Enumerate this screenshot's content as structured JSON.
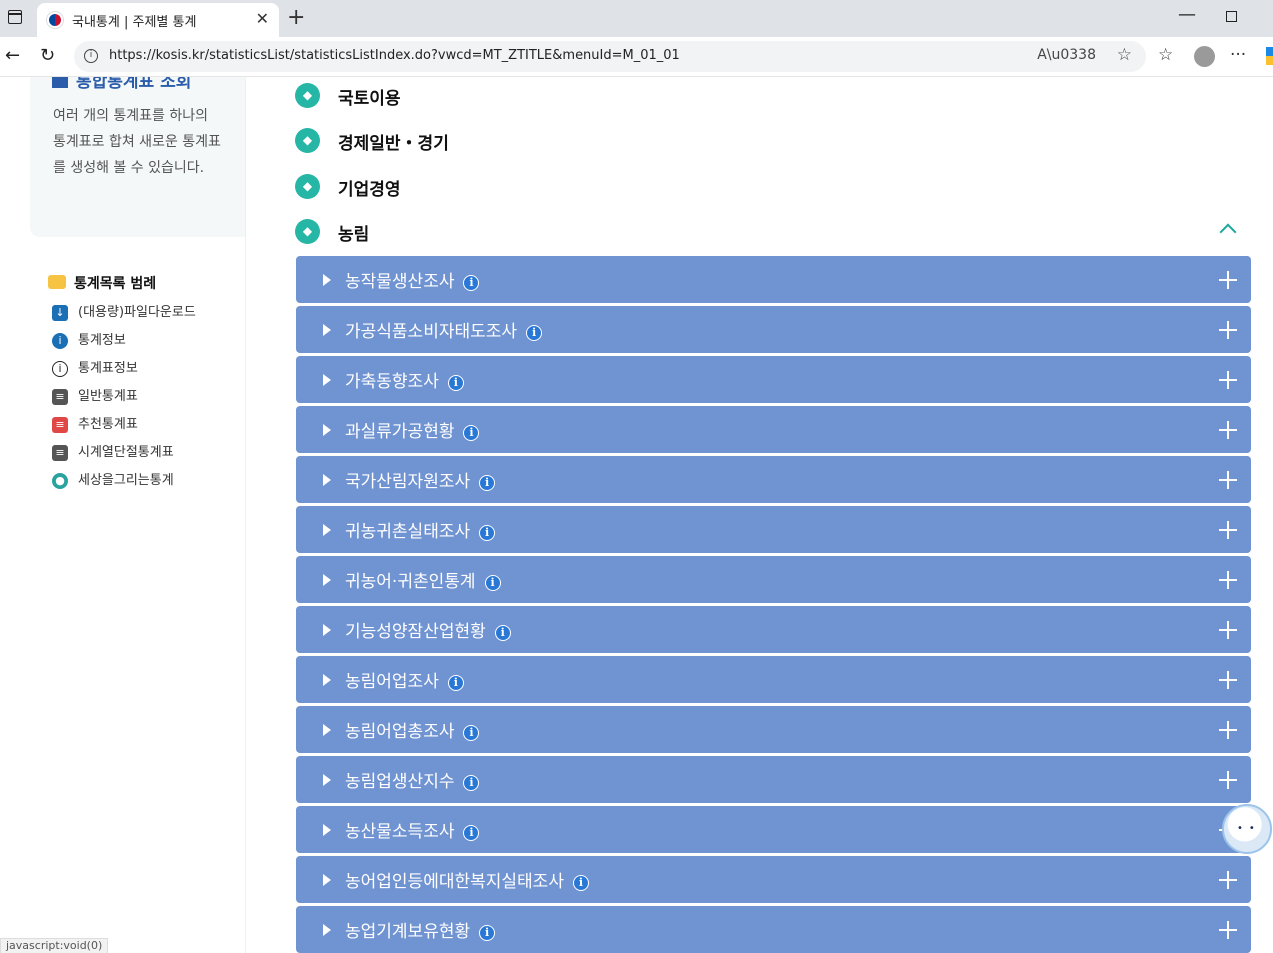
{
  "browser": {
    "tab_title": "국내통계 | 주제별 통계",
    "url": "https://kosis.kr/statisticsList/statisticsListIndex.do?vwcd=MT_ZTITLE&menuId=M_01_01",
    "read_aloud": "A̸"
  },
  "sidebar": {
    "promo_title": "통합통계표 조회",
    "promo_desc": "여러 개의 통계표를 하나의 통계표로 합쳐 새로운 통계표를 생성해 볼 수 있습니다.",
    "legend_title": "통계목록 범례",
    "legend_items": [
      {
        "label": "(대용량)파일다운로드",
        "icon": "download-icon",
        "color": "#1a6fb5"
      },
      {
        "label": "통계정보",
        "icon": "info-filled-icon",
        "color": "#1a6fb5"
      },
      {
        "label": "통계표정보",
        "icon": "info-outline-icon",
        "color": "#333333"
      },
      {
        "label": "일반통계표",
        "icon": "table-icon",
        "color": "#555555"
      },
      {
        "label": "추천통계표",
        "icon": "recommend-table-icon",
        "color": "#e04848"
      },
      {
        "label": "시계열단절통계표",
        "icon": "series-break-icon",
        "color": "#555555"
      },
      {
        "label": "세상을그리는통계",
        "icon": "globe-chart-icon",
        "color": "#29a3a0"
      }
    ]
  },
  "categories": [
    {
      "label": "국토이용",
      "icon": "land-use-icon"
    },
    {
      "label": "경제일반・경기",
      "icon": "economy-icon"
    },
    {
      "label": "기업경영",
      "icon": "business-icon"
    },
    {
      "label": "농림",
      "icon": "agriculture-icon",
      "expanded": true
    }
  ],
  "rows": [
    {
      "label": "농작물생산조사"
    },
    {
      "label": "가공식품소비자태도조사"
    },
    {
      "label": "가축동향조사"
    },
    {
      "label": "과실류가공현황"
    },
    {
      "label": "국가산림자원조사"
    },
    {
      "label": "귀농귀촌실태조사"
    },
    {
      "label": "귀농어·귀촌인통계"
    },
    {
      "label": "기능성양잠산업현황"
    },
    {
      "label": "농림어업조사"
    },
    {
      "label": "농림어업총조사"
    },
    {
      "label": "농림업생산지수"
    },
    {
      "label": "농산물소득조사"
    },
    {
      "label": "농어업인등에대한복지실태조사"
    },
    {
      "label": "농업기계보유현황"
    }
  ],
  "status_text": "javascript:void(0)",
  "colors": {
    "row_bg": "#7093d2",
    "category_icon": "#25b6a6",
    "info_badge": "#2a78d6"
  }
}
